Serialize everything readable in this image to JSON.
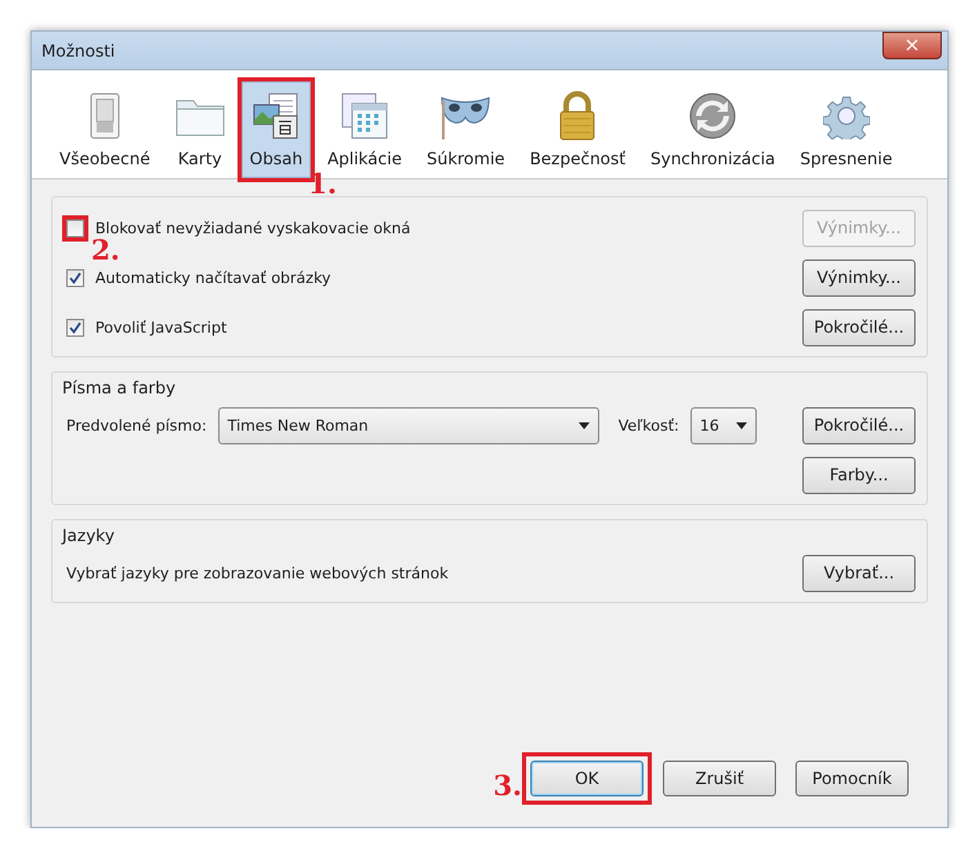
{
  "window": {
    "title": "Možnosti",
    "close": "×"
  },
  "tabs": [
    {
      "label": "Všeobecné",
      "selected": false,
      "highlighted": false
    },
    {
      "label": "Karty",
      "selected": false,
      "highlighted": false
    },
    {
      "label": "Obsah",
      "selected": true,
      "highlighted": true,
      "step": "1."
    },
    {
      "label": "Aplikácie",
      "selected": false,
      "highlighted": false
    },
    {
      "label": "Súkromie",
      "selected": false,
      "highlighted": false
    },
    {
      "label": "Bezpečnosť",
      "selected": false,
      "highlighted": false
    },
    {
      "label": "Synchronizácia",
      "selected": false,
      "highlighted": false
    },
    {
      "label": "Spresnenie",
      "selected": false,
      "highlighted": false
    }
  ],
  "options": [
    {
      "label": "Blokovať nevyžiadané vyskakovacie okná",
      "checked": false,
      "highlighted": true,
      "step": "2.",
      "button": {
        "label": "Výnimky...",
        "disabled": true
      }
    },
    {
      "label": "Automaticky načítavať obrázky",
      "checked": true,
      "highlighted": false,
      "button": {
        "label": "Výnimky...",
        "disabled": false
      }
    },
    {
      "label": "Povoliť JavaScript",
      "checked": true,
      "highlighted": false,
      "button": {
        "label": "Pokročilé...",
        "disabled": false
      }
    }
  ],
  "fonts": {
    "title": "Písma a farby",
    "font_label": "Predvolené písmo:",
    "font_value": "Times New Roman",
    "size_label": "Veľkosť:",
    "size_value": "16",
    "buttons": [
      "Pokročilé...",
      "Farby..."
    ]
  },
  "languages": {
    "title": "Jazyky",
    "text": "Vybrať jazyky pre zobrazovanie webových stránok",
    "button": "Vybrať..."
  },
  "buttons": [
    {
      "label": "OK",
      "default": true,
      "highlighted": true,
      "step": "3."
    },
    {
      "label": "Zrušiť",
      "default": false,
      "highlighted": false
    },
    {
      "label": "Pomocník",
      "default": false,
      "highlighted": false
    }
  ]
}
